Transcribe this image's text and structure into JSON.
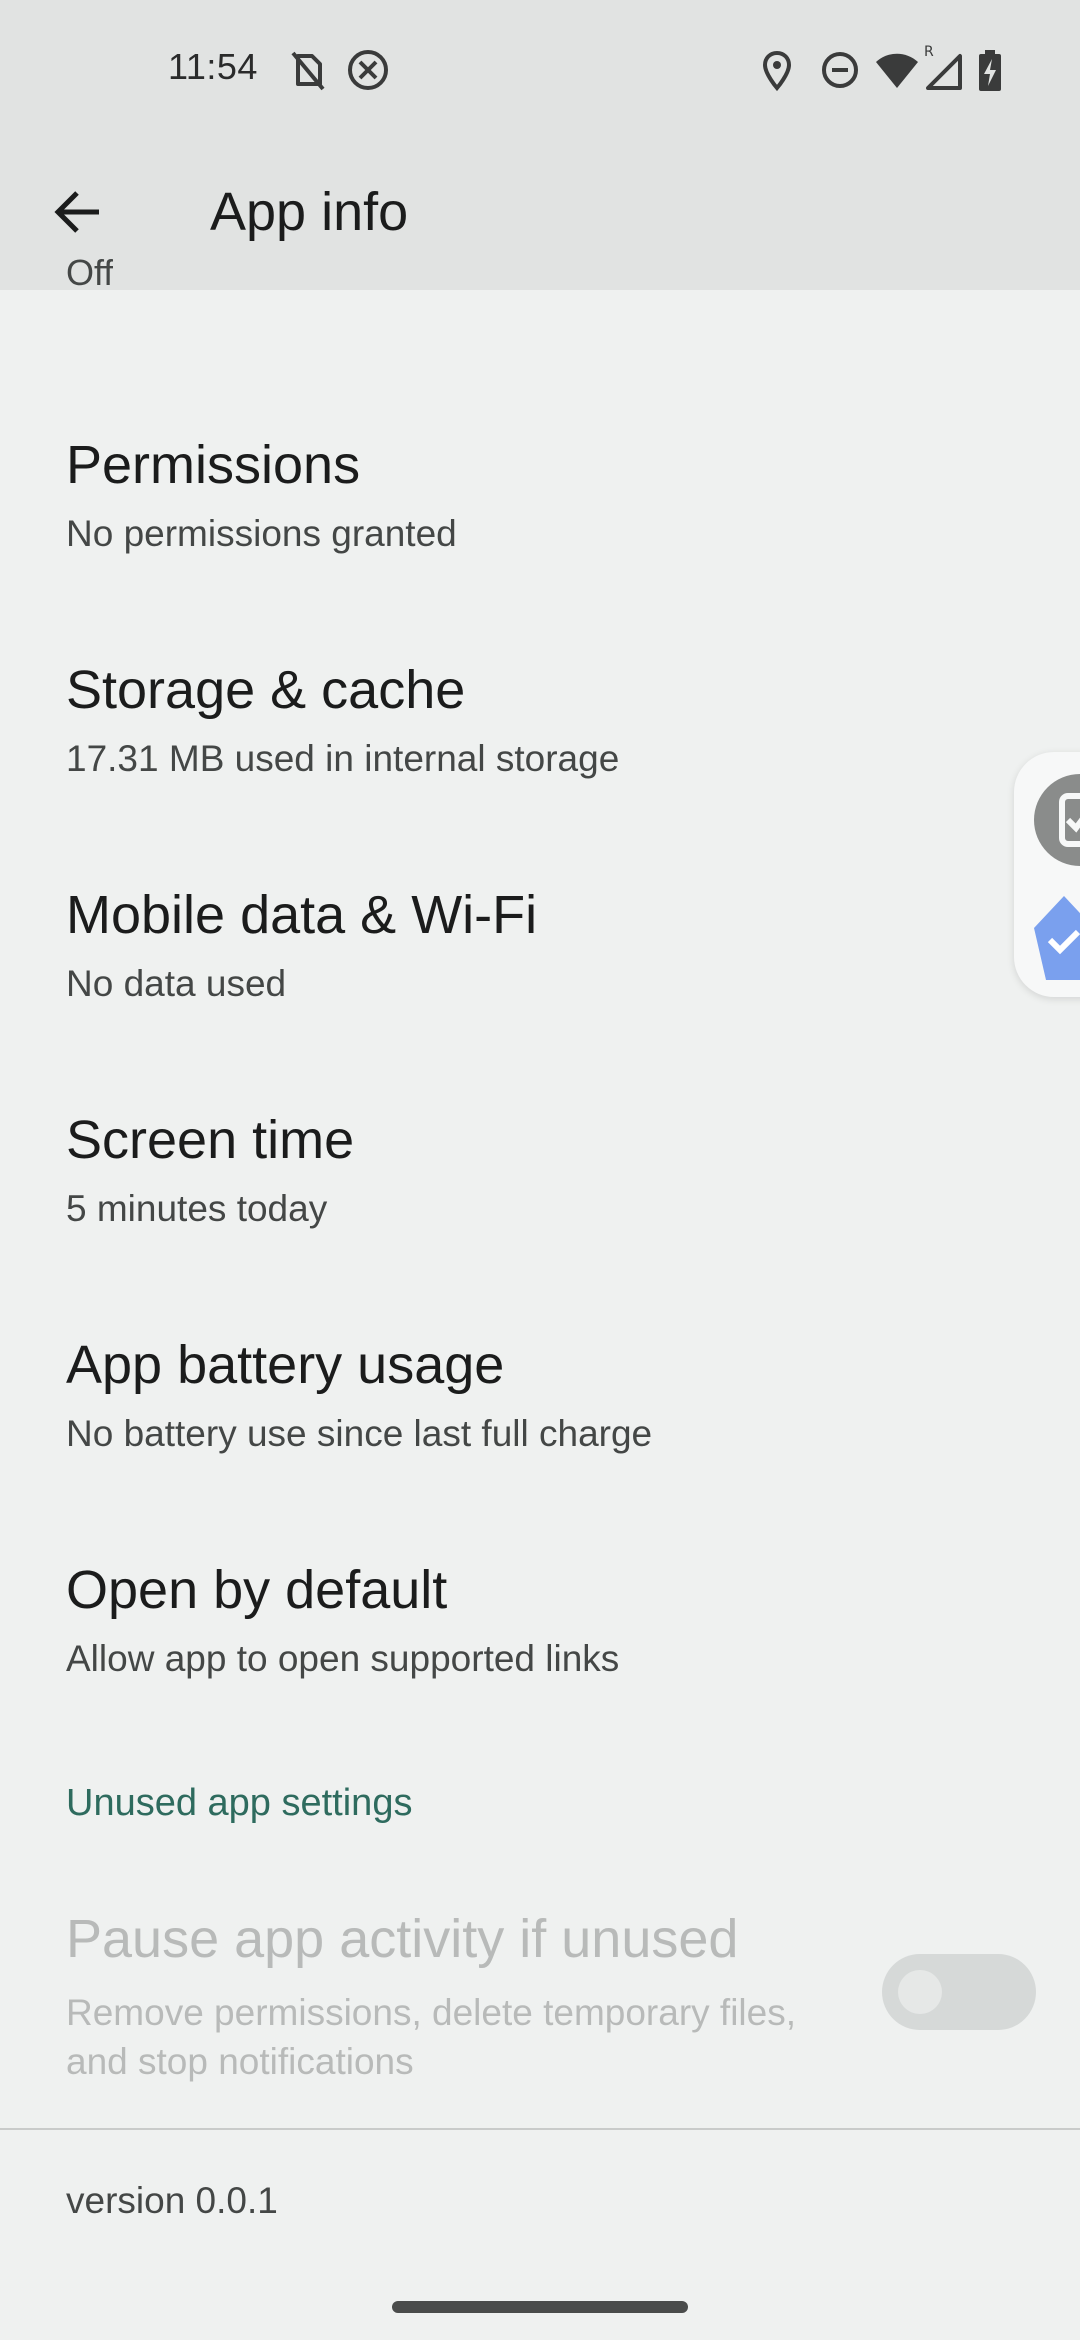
{
  "status_bar": {
    "time": "11:54",
    "icons": [
      "no-sim-icon",
      "blocked-icon",
      "location-icon",
      "do-not-disturb-icon",
      "wifi-icon",
      "signal-roaming-icon",
      "battery-charging-icon"
    ],
    "roaming_label": "R"
  },
  "app_bar": {
    "back_icon": "arrow-back-icon",
    "title": "App info"
  },
  "partial_item_text": "Off",
  "items": [
    {
      "title": "Permissions",
      "summary": "No permissions granted"
    },
    {
      "title": "Storage & cache",
      "summary": "17.31 MB used in internal storage"
    },
    {
      "title": "Mobile data & Wi-Fi",
      "summary": "No data used"
    },
    {
      "title": "Screen time",
      "summary": "5 minutes today"
    },
    {
      "title": "App battery usage",
      "summary": "No battery use since last full charge"
    },
    {
      "title": "Open by default",
      "summary": "Allow app to open supported links"
    }
  ],
  "unused_section": {
    "header": "Unused app settings",
    "pause_title": "Pause app activity if unused",
    "pause_summary": "Remove permissions, delete temporary files, and stop notifications",
    "pause_enabled": false
  },
  "version": "version 0.0.1",
  "colors": {
    "background": "#eff1f0",
    "app_bar": "#e1e3e2",
    "section_accent": "#2e6b5e",
    "disabled_text": "#b8bab9",
    "overlay_accent": "#7aa0ee"
  }
}
